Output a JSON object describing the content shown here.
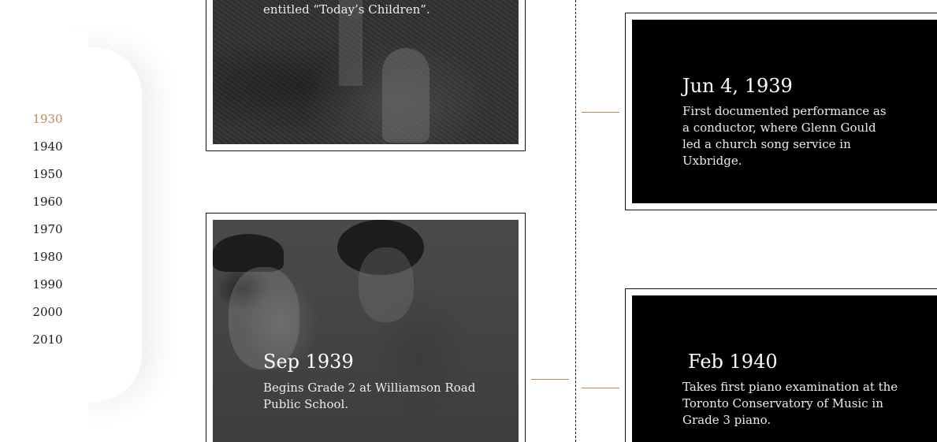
{
  "decades": [
    "1930",
    "1940",
    "1950",
    "1960",
    "1970",
    "1980",
    "1990",
    "2000",
    "2010"
  ],
  "active_decade": "1930",
  "colors": {
    "accent": "#b88a62",
    "connector": "#b08a66",
    "card_border": "#111111",
    "card_black": "#000000"
  },
  "events": [
    {
      "date": "",
      "text": "entitled “Today’s Children”."
    },
    {
      "date": "Jun 4, 1939",
      "text": "First documented performance as a conductor, where Glenn Gould led a church song service in Uxbridge."
    },
    {
      "date": "Sep 1939",
      "text": "Begins Grade 2 at Williamson Road Public School."
    },
    {
      "date": "Feb 1940",
      "text": "Takes first piano examination at the Toronto Conservatory of Music in Grade 3 piano."
    }
  ]
}
